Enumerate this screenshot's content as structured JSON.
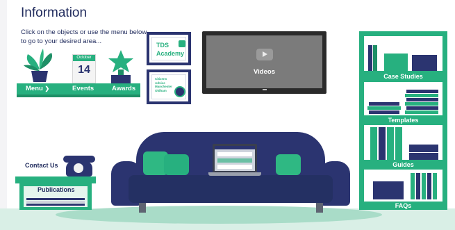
{
  "page": {
    "title": "Information",
    "intro": "Click on the objects or use the menu below to go to your desired area..."
  },
  "shelf": {
    "menu_label": "Menu",
    "events_label": "Events",
    "awards_label": "Awards",
    "calendar_month": "October",
    "calendar_day": "14"
  },
  "frames": {
    "academy_line1": "TDS",
    "academy_line2": "Academy",
    "citizens_text": "Citizens Advice Manchester Oldham"
  },
  "tv": {
    "label": "Videos"
  },
  "bookcase": {
    "case_studies": "Case Studies",
    "templates": "Templates",
    "guides": "Guides",
    "faqs": "FAQs"
  },
  "side": {
    "contact_us": "Contact Us",
    "publications": "Publications"
  },
  "colors": {
    "navy": "#2b3470",
    "green": "#27b07f",
    "light_green": "#d9efe6"
  },
  "icons": [
    "plant-icon",
    "calendar-icon",
    "trophy-icon",
    "chevron-down-icon",
    "play-icon",
    "telephone-icon",
    "laptop-icon",
    "robot-icon",
    "box-icon",
    "folder-icon"
  ]
}
